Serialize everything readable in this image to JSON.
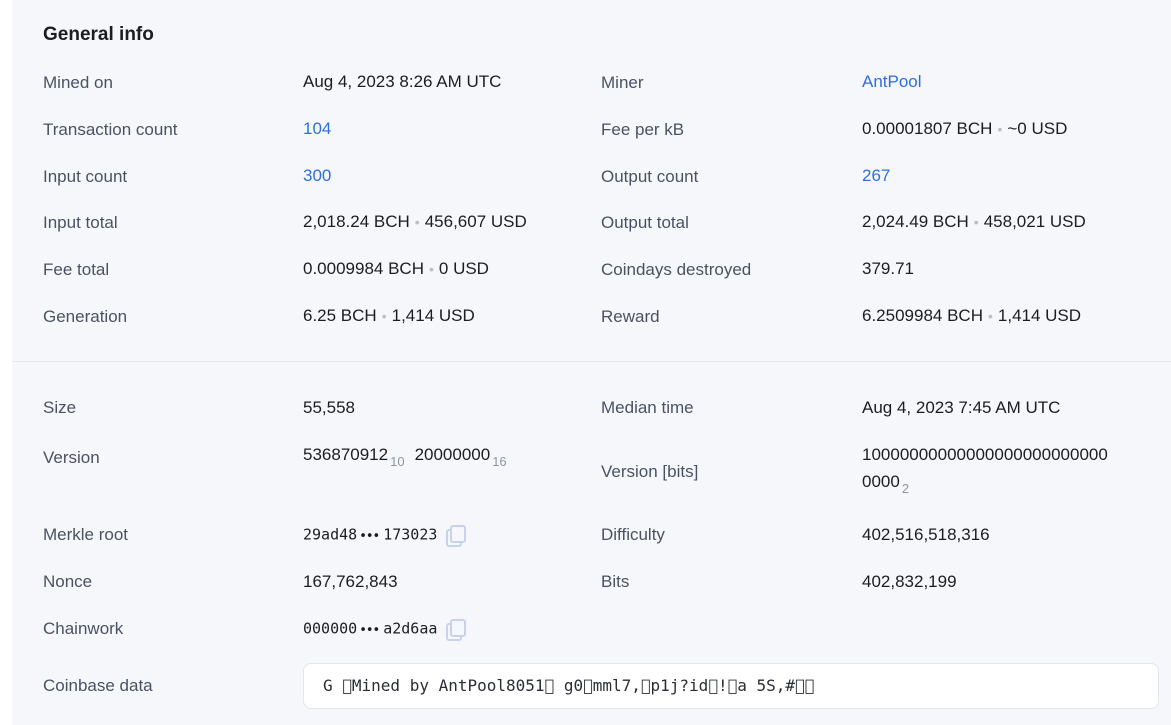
{
  "section_title": "General info",
  "general": {
    "mined_on": {
      "label": "Mined on",
      "value": "Aug 4, 2023 8:26 AM UTC"
    },
    "miner": {
      "label": "Miner",
      "value": "AntPool"
    },
    "transaction_count": {
      "label": "Transaction count",
      "value": "104"
    },
    "fee_per_kb": {
      "label": "Fee per kB",
      "value": "0.00001807 BCH",
      "usd": "~0 USD"
    },
    "input_count": {
      "label": "Input count",
      "value": "300"
    },
    "output_count": {
      "label": "Output count",
      "value": "267"
    },
    "input_total": {
      "label": "Input total",
      "value": "2,018.24 BCH",
      "usd": "456,607 USD"
    },
    "output_total": {
      "label": "Output total",
      "value": "2,024.49 BCH",
      "usd": "458,021 USD"
    },
    "fee_total": {
      "label": "Fee total",
      "value": "0.0009984 BCH",
      "usd": "0 USD"
    },
    "coindays_destroyed": {
      "label": "Coindays destroyed",
      "value": "379.71"
    },
    "generation": {
      "label": "Generation",
      "value": "6.25 BCH",
      "usd": "1,414 USD"
    },
    "reward": {
      "label": "Reward",
      "value": "6.2509984 BCH",
      "usd": "1,414 USD"
    }
  },
  "technical": {
    "size": {
      "label": "Size",
      "value": "55,558"
    },
    "median_time": {
      "label": "Median time",
      "value": "Aug 4, 2023 7:45 AM UTC"
    },
    "version": {
      "label": "Version",
      "decimal": "536870912",
      "decimal_base": "10",
      "hex": "20000000",
      "hex_base": "16"
    },
    "version_bits": {
      "label": "Version [bits]",
      "line1": "10000000000000000000000000",
      "line2": "0000",
      "base": "2"
    },
    "merkle_root": {
      "label": "Merkle root",
      "start": "29ad48",
      "dots": "•••",
      "end": "173023"
    },
    "difficulty": {
      "label": "Difficulty",
      "value": "402,516,518,316"
    },
    "nonce": {
      "label": "Nonce",
      "value": "167,762,843"
    },
    "bits": {
      "label": "Bits",
      "value": "402,832,199"
    },
    "chainwork": {
      "label": "Chainwork",
      "start": "000000",
      "dots": "•••",
      "end": "a2d6aa"
    },
    "coinbase_data": {
      "label": "Coinbase data",
      "value": "G \u0000Mined by AntPool8051\u0000 g0\u0000mml7,\u0000p1j?id\u0000!\u0000a 5S,#\u0000\u0000"
    }
  },
  "separator": "•",
  "colors": {
    "link": "#2f6fdc",
    "panel": "#f6f7fb",
    "label": "#4a5261"
  }
}
